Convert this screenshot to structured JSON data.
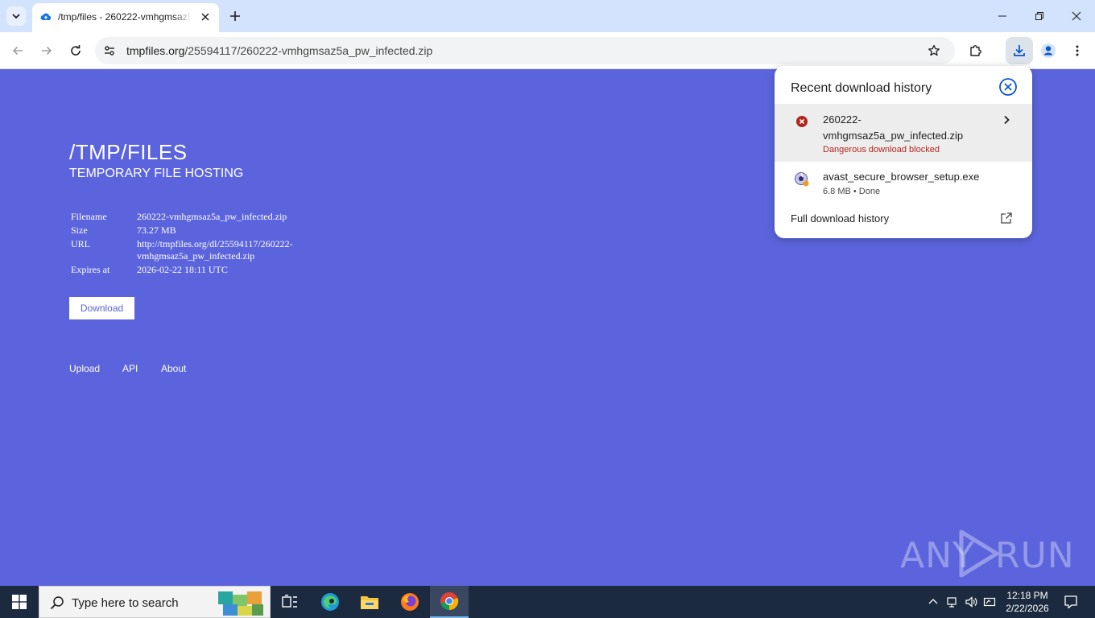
{
  "browser": {
    "tab_title": "/tmp/files - 260222-vmhgmsaz5a",
    "url_host": "tmpfiles.org",
    "url_path": "/25594117/260222-vmhgmsaz5a_pw_infected.zip"
  },
  "page": {
    "title": "/TMP/FILES",
    "subtitle": "TEMPORARY FILE HOSTING",
    "fields": [
      {
        "label": "Filename",
        "value": "260222-vmhgmsaz5a_pw_infected.zip"
      },
      {
        "label": "Size",
        "value": "73.27 MB"
      },
      {
        "label": "URL",
        "value": "http://tmpfiles.org/dl/25594117/260222-vmhgmsaz5a_pw_infected.zip"
      },
      {
        "label": "Expires at",
        "value": "2026-02-22 18:11 UTC"
      }
    ],
    "download_label": "Download",
    "footer_links": [
      "Upload",
      "API",
      "About"
    ]
  },
  "downloads_bubble": {
    "header": "Recent download history",
    "items": [
      {
        "name": "260222-vmhgmsaz5a_pw_infected.zip",
        "name_line1": "260222-",
        "name_line2": "vmhgmsaz5a_pw_infected.zip",
        "status": "Dangerous download blocked",
        "icon": "error-icon"
      },
      {
        "name": "avast_secure_browser_setup.exe",
        "status": "6.8 MB • Done",
        "icon": "installer-icon"
      }
    ],
    "full_history_label": "Full download history"
  },
  "watermark": {
    "left": "ANY",
    "right": "RUN"
  },
  "taskbar": {
    "search_placeholder": "Type here to search",
    "time": "12:18 PM",
    "date": "2/22/2026"
  },
  "colors": {
    "page_bg": "#5b64dc",
    "danger": "#b3261e",
    "taskbar": "#1c2a40"
  }
}
